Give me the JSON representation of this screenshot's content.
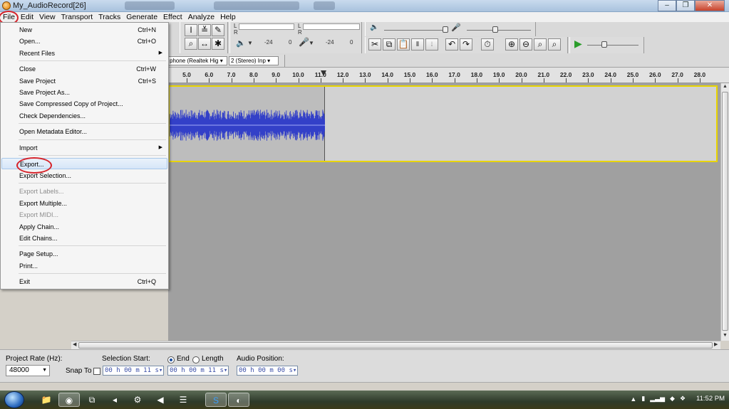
{
  "window": {
    "title": "My_AudioRecord[26]",
    "minimize": "–",
    "restore": "❐",
    "close": "✕"
  },
  "menubar": {
    "items": [
      "File",
      "Edit",
      "View",
      "Transport",
      "Tracks",
      "Generate",
      "Effect",
      "Analyze",
      "Help"
    ]
  },
  "toolbar": {
    "meter_left": "L",
    "meter_right": "R",
    "db_a": "-24",
    "db_b": "0",
    "db_c": "-24",
    "db_d": "0",
    "input_device": "phone (Realtek Hig",
    "input_channels": "2 (Stereo) Inp"
  },
  "ruler": {
    "labels": [
      "5.0",
      "6.0",
      "7.0",
      "8.0",
      "9.0",
      "10.0",
      "11.0",
      "12.0",
      "13.0",
      "14.0",
      "15.0",
      "16.0",
      "17.0",
      "18.0",
      "19.0",
      "20.0",
      "21.0",
      "22.0",
      "23.0",
      "24.0",
      "25.0",
      "26.0",
      "27.0",
      "28.0"
    ]
  },
  "file_menu": {
    "items": [
      {
        "label": "New",
        "shortcut": "Ctrl+N"
      },
      {
        "label": "Open...",
        "shortcut": "Ctrl+O"
      },
      {
        "label": "Recent Files",
        "submenu": true
      },
      {
        "label": "Close",
        "shortcut": "Ctrl+W"
      },
      {
        "label": "Save Project",
        "shortcut": "Ctrl+S"
      },
      {
        "label": "Save Project As..."
      },
      {
        "label": "Save Compressed Copy of Project..."
      },
      {
        "label": "Check Dependencies..."
      },
      {
        "label": "Open Metadata Editor..."
      },
      {
        "label": "Import",
        "submenu": true
      },
      {
        "label": "Export...",
        "highlighted": true
      },
      {
        "label": "Export Selection..."
      },
      {
        "label": "Export Labels...",
        "disabled": true
      },
      {
        "label": "Export Multiple..."
      },
      {
        "label": "Export MIDI...",
        "disabled": true
      },
      {
        "label": "Apply Chain..."
      },
      {
        "label": "Edit Chains..."
      },
      {
        "label": "Page Setup..."
      },
      {
        "label": "Print..."
      },
      {
        "label": "Exit",
        "shortcut": "Ctrl+Q"
      }
    ]
  },
  "selection_bar": {
    "project_rate_label": "Project Rate (Hz):",
    "project_rate": "48000",
    "snap_to_label": "Snap To",
    "selection_start_label": "Selection Start:",
    "end_label": "End",
    "length_label": "Length",
    "audio_position_label": "Audio Position:",
    "selection_start": "00 h 00 m 11 s",
    "selection_end": "00 h 00 m 11 s",
    "audio_position": "00 h 00 m 00 s"
  },
  "taskbar": {
    "clock": "11:52 PM"
  },
  "colors": {
    "waveform": "#3340c8",
    "track_border": "#e8d400",
    "annotation": "#d6242b"
  }
}
